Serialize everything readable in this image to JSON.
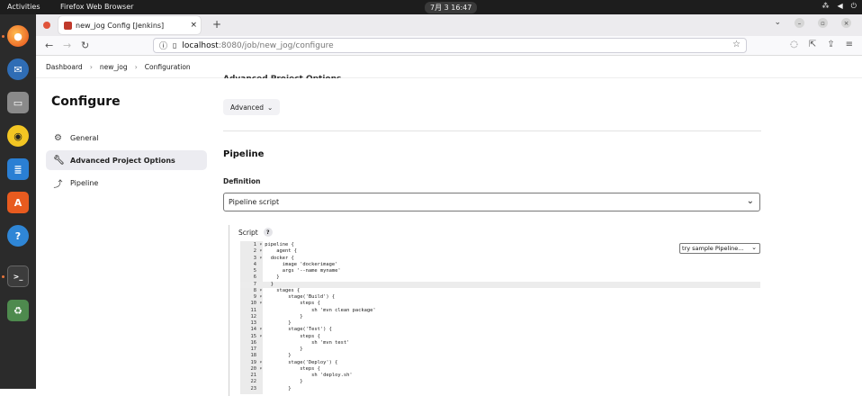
{
  "system": {
    "activities": "Activities",
    "app_name": "Firefox Web Browser",
    "clock": "7月 3  16:47"
  },
  "browser": {
    "tab_title": "new_jog Config [Jenkins]",
    "url_host": "localhost",
    "url_path": ":8080/job/new_jog/configure"
  },
  "breadcrumbs": [
    "Dashboard",
    "new_jog",
    "Configuration"
  ],
  "page": {
    "title": "Configure",
    "sidebar": [
      {
        "label": "General",
        "icon": "gear-icon"
      },
      {
        "label": "Advanced Project Options",
        "icon": "wrench-icon"
      },
      {
        "label": "Pipeline",
        "icon": "pipeline-icon"
      }
    ],
    "cutoff_heading": "Advanced Project Options",
    "advanced_button": "Advanced",
    "section_heading": "Pipeline",
    "definition_label": "Definition",
    "definition_value": "Pipeline script",
    "script_label": "Script",
    "help_glyph": "?",
    "try_sample": "try sample Pipeline...",
    "code_lines": [
      {
        "n": "1",
        "f": "▾",
        "t": "pipeline {"
      },
      {
        "n": "2",
        "f": "▾",
        "t": "    agent {"
      },
      {
        "n": "3",
        "f": "▾",
        "t": "  docker {"
      },
      {
        "n": "4",
        "f": "",
        "t": "      image 'dockerimage'"
      },
      {
        "n": "5",
        "f": "",
        "t": "      args '--name myname'"
      },
      {
        "n": "6",
        "f": "",
        "t": "    }"
      },
      {
        "n": "7",
        "f": "",
        "t": "  }"
      },
      {
        "n": "8",
        "f": "▾",
        "t": "    stages {"
      },
      {
        "n": "9",
        "f": "▾",
        "t": "        stage('Build') {"
      },
      {
        "n": "10",
        "f": "▾",
        "t": "            steps {"
      },
      {
        "n": "11",
        "f": "",
        "t": "                sh 'mvn clean package'"
      },
      {
        "n": "12",
        "f": "",
        "t": "            }"
      },
      {
        "n": "13",
        "f": "",
        "t": "        }"
      },
      {
        "n": "14",
        "f": "▾",
        "t": "        stage('Test') {"
      },
      {
        "n": "15",
        "f": "▾",
        "t": "            steps {"
      },
      {
        "n": "16",
        "f": "",
        "t": "                sh 'mvn test'"
      },
      {
        "n": "17",
        "f": "",
        "t": "            }"
      },
      {
        "n": "18",
        "f": "",
        "t": "        }"
      },
      {
        "n": "19",
        "f": "▾",
        "t": "        stage('Deploy') {"
      },
      {
        "n": "20",
        "f": "▾",
        "t": "            steps {"
      },
      {
        "n": "21",
        "f": "",
        "t": "                sh 'deploy.sh'"
      },
      {
        "n": "22",
        "f": "",
        "t": "            }"
      },
      {
        "n": "23",
        "f": "",
        "t": "        }"
      }
    ],
    "highlighted_line": "7"
  }
}
